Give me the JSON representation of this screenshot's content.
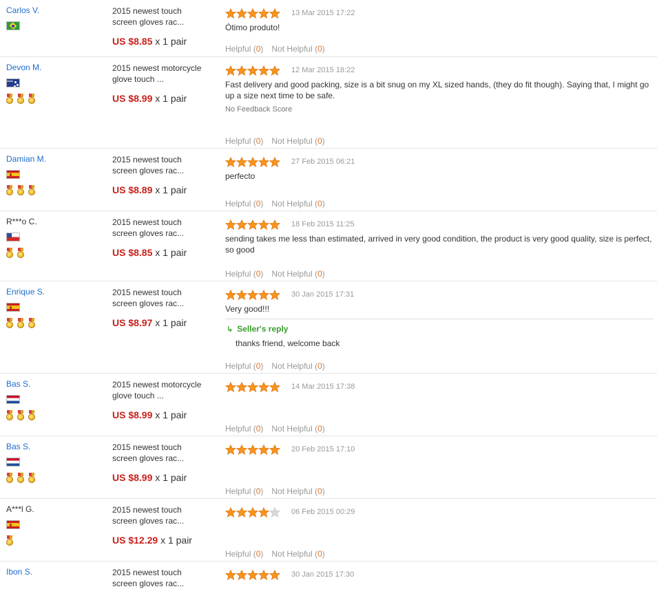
{
  "reviews": [
    {
      "user": "Carlos V.",
      "user_linked": true,
      "flag": "brazil-flag",
      "medals": 0,
      "product": [
        "2015 newest touch",
        "screen gloves rac..."
      ],
      "price": "US $8.85",
      "qty": "x 1 pair",
      "rating": 5,
      "date": "13 Mar 2015 17:22",
      "text": "Ótimo produto!",
      "helpful_label": "Helpful",
      "helpful_count": "0",
      "not_helpful_label": "Not Helpful",
      "not_helpful_count": "0"
    },
    {
      "user": "Devon M.",
      "user_linked": true,
      "flag": "australia-flag",
      "medals": 3,
      "product": [
        "2015 newest motorcycle",
        "glove touch ..."
      ],
      "price": "US $8.99",
      "qty": "x 1 pair",
      "rating": 5,
      "date": "12 Mar 2015 18:22",
      "text": "Fast delivery and good packing, size is a bit snug on my XL sized hands, (they do fit though). Saying that, I might go up a size next time to be safe.",
      "no_score": "No Feedback Score",
      "helpful_label": "Helpful",
      "helpful_count": "0",
      "not_helpful_label": "Not Helpful",
      "not_helpful_count": "0"
    },
    {
      "user": "Damian M.",
      "user_linked": true,
      "flag": "spain-flag",
      "medals": 3,
      "product": [
        "2015 newest touch",
        "screen gloves rac..."
      ],
      "price": "US $8.89",
      "qty": "x 1 pair",
      "rating": 5,
      "date": "27 Feb 2015 06:21",
      "text": "perfecto",
      "helpful_label": "Helpful",
      "helpful_count": "0",
      "not_helpful_label": "Not Helpful",
      "not_helpful_count": "0"
    },
    {
      "user": "R***o C.",
      "user_linked": false,
      "flag": "chile-flag",
      "medals": 2,
      "product": [
        "2015 newest touch",
        "screen gloves rac..."
      ],
      "price": "US $8.85",
      "qty": "x 1 pair",
      "rating": 5,
      "date": "18 Feb 2015 11:25",
      "text": "sending takes me less than estimated, arrived in very good condition, the product is very good quality, size is perfect, so good",
      "helpful_label": "Helpful",
      "helpful_count": "0",
      "not_helpful_label": "Not Helpful",
      "not_helpful_count": "0"
    },
    {
      "user": "Enrique S.",
      "user_linked": true,
      "flag": "spain-flag",
      "medals": 3,
      "product": [
        "2015 newest touch",
        "screen gloves rac..."
      ],
      "price": "US $8.97",
      "qty": "x 1 pair",
      "rating": 5,
      "date": "30 Jan 2015 17:31",
      "text": "Very good!!!",
      "reply_title": "Seller's reply",
      "reply_text": "thanks friend, welcome back",
      "helpful_label": "Helpful",
      "helpful_count": "0",
      "not_helpful_label": "Not Helpful",
      "not_helpful_count": "0"
    },
    {
      "user": "Bas S.",
      "user_linked": true,
      "flag": "netherlands-flag",
      "medals": 3,
      "product": [
        "2015 newest motorcycle",
        "glove touch ..."
      ],
      "price": "US $8.99",
      "qty": "x 1 pair",
      "rating": 5,
      "date": "14 Mar 2015 17:38",
      "text": "",
      "helpful_label": "Helpful",
      "helpful_count": "0",
      "not_helpful_label": "Not Helpful",
      "not_helpful_count": "0"
    },
    {
      "user": "Bas S.",
      "user_linked": true,
      "flag": "netherlands-flag",
      "medals": 3,
      "product": [
        "2015 newest touch",
        "screen gloves rac..."
      ],
      "price": "US $8.99",
      "qty": "x 1 pair",
      "rating": 5,
      "date": "20 Feb 2015 17:10",
      "text": "",
      "helpful_label": "Helpful",
      "helpful_count": "0",
      "not_helpful_label": "Not Helpful",
      "not_helpful_count": "0"
    },
    {
      "user": "A***l G.",
      "user_linked": false,
      "flag": "spain-flag",
      "medals": 1,
      "product": [
        "2015 newest touch",
        "screen gloves rac..."
      ],
      "price": "US $12.29",
      "qty": "x 1 pair",
      "rating": 4,
      "date": "06 Feb 2015 00:29",
      "text": "",
      "helpful_label": "Helpful",
      "helpful_count": "0",
      "not_helpful_label": "Not Helpful",
      "not_helpful_count": "0"
    },
    {
      "user": "Ibon S.",
      "user_linked": true,
      "flag": "",
      "medals": 0,
      "product": [
        "2015 newest touch",
        "screen gloves rac..."
      ],
      "rating": 5,
      "date": "30 Jan 2015 17:30",
      "text": ""
    }
  ],
  "colors": {
    "price": "#c7211c",
    "username_link": "#1e6ccf",
    "star_on": "#f7941d",
    "star_off": "#d9d9d9",
    "helpful_count": "#e0752a",
    "seller_reply": "#3a9c2c"
  }
}
